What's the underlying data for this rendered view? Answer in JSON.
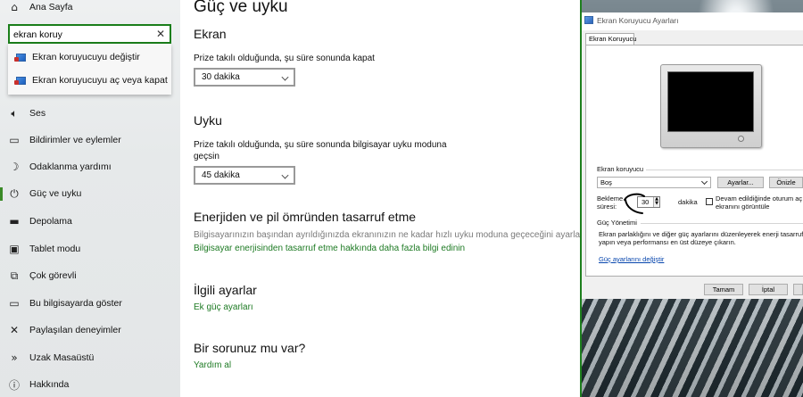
{
  "sidebar": {
    "home_label": "Ana Sayfa",
    "search": {
      "value": "ekran koruy",
      "placeholder": "",
      "clear_icon": "close-icon"
    },
    "suggestions": [
      {
        "label": "Ekran koruyucuyu değiştir",
        "icon": "monitor-icon"
      },
      {
        "label": "Ekran koruyucuyu aç veya kapat",
        "icon": "monitor-icon"
      }
    ],
    "items": [
      {
        "label": "Ses",
        "icon": "speaker-icon",
        "glyph": "🔈︎"
      },
      {
        "label": "Bildirimler ve eylemler",
        "icon": "notification-icon",
        "glyph": "▭"
      },
      {
        "label": "Odaklanma yardımı",
        "icon": "moon-icon",
        "glyph": "☽"
      },
      {
        "label": "Güç ve uyku",
        "icon": "power-icon",
        "glyph": "⏻",
        "active": true
      },
      {
        "label": "Depolama",
        "icon": "storage-icon",
        "glyph": "▬"
      },
      {
        "label": "Tablet modu",
        "icon": "tablet-icon",
        "glyph": "▣"
      },
      {
        "label": "Çok görevli",
        "icon": "multitask-icon",
        "glyph": "⧉"
      },
      {
        "label": "Bu bilgisayarda göster",
        "icon": "project-icon",
        "glyph": "▭"
      },
      {
        "label": "Paylaşılan deneyimler",
        "icon": "shared-icon",
        "glyph": "✕"
      },
      {
        "label": "Uzak Masaüstü",
        "icon": "remote-icon",
        "glyph": "»"
      },
      {
        "label": "Hakkında",
        "icon": "info-icon",
        "glyph": "ⓘ"
      }
    ],
    "home_glyph": "⌂",
    "accent": "#3a8a27"
  },
  "main": {
    "title": "Güç ve uyku",
    "screen": {
      "heading": "Ekran",
      "label": "Prize takılı olduğunda, şu süre sonunda kapat",
      "value": "30 dakika"
    },
    "sleep": {
      "heading": "Uyku",
      "label": "Prize takılı olduğunda, şu süre sonunda bilgisayar uyku moduna geçsin",
      "value": "45 dakika"
    },
    "energy": {
      "heading": "Enerjiden ve pil ömründen tasarruf etme",
      "desc": "Bilgisayarınızın başından ayrıldığınızda ekranınızın ne kadar hızlı uyku moduna geçeceğini ayarlayın.",
      "link": "Bilgisayar enerjisinden tasarruf etme hakkında daha fazla bilgi edinin"
    },
    "related": {
      "heading": "İlgili ayarlar",
      "link": "Ek güç ayarları"
    },
    "question": {
      "heading": "Bir sorunuz mu var?",
      "link": "Yardım al"
    },
    "link_color": "#1d7a23"
  },
  "dialog": {
    "title": "Ekran Koruyucu Ayarları",
    "tab": "Ekran Koruyucu",
    "screensaver_group": "Ekran koruyucu",
    "selected": "Boş",
    "settings_button": "Ayarlar...",
    "preview_button": "Önizle",
    "wait_label_1": "Bekleme",
    "wait_label_2": "süresi:",
    "wait_value": "30",
    "minutes": "dakika",
    "resume_1": "Devam edildiğinde oturum aç",
    "resume_2": "ekranını görüntüle",
    "power_group": "Güç Yönetimi",
    "power_desc_1": "Ekran parlaklığını ve diğer güç ayarlarını düzenleyerek enerji tasarrufu",
    "power_desc_2": "yapın veya performansı en üst düzeye çıkarın.",
    "power_link": "Güç ayarlarını değiştir",
    "ok_button": "Tamam",
    "cancel_button": "İptal"
  }
}
